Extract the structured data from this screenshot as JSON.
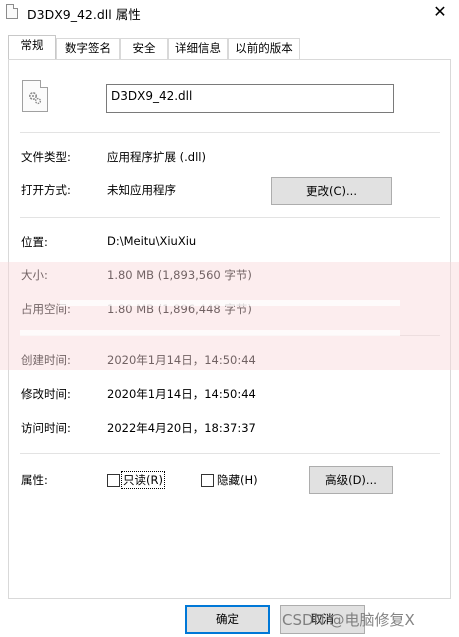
{
  "window": {
    "title": "D3DX9_42.dll 属性",
    "close_glyph": "✕"
  },
  "tabs": [
    {
      "label": "常规"
    },
    {
      "label": "数字签名"
    },
    {
      "label": "安全"
    },
    {
      "label": "详细信息"
    },
    {
      "label": "以前的版本"
    }
  ],
  "general": {
    "file_name": "D3DX9_42.dll",
    "file_type_label": "文件类型:",
    "file_type_value": "应用程序扩展 (.dll)",
    "opens_with_label": "打开方式:",
    "opens_with_value": "未知应用程序",
    "change_button": "更改(C)...",
    "location_label": "位置:",
    "location_value": "D:\\Meitu\\XiuXiu",
    "size_label": "大小:",
    "size_value": "1.80 MB (1,893,560 字节)",
    "size_on_disk_label": "占用空间:",
    "size_on_disk_value": "1.80 MB (1,896,448 字节)",
    "created_label": "创建时间:",
    "created_value": "2020年1月14日，14:50:44",
    "modified_label": "修改时间:",
    "modified_value": "2020年1月14日，14:50:44",
    "accessed_label": "访问时间:",
    "accessed_value": "2022年4月20日，18:37:37",
    "attributes_label": "属性:",
    "readonly_label": "只读(R)",
    "hidden_label": "隐藏(H)",
    "advanced_button": "高级(D)..."
  },
  "footer": {
    "ok_button": "确定",
    "cancel_button": "取消"
  },
  "overlay": {
    "watermark": "CSDN @电脑修复X"
  },
  "colors": {
    "accent": "#0078d7",
    "banner": "#f8d7da"
  },
  "icons": {
    "file_icon": "dll-file-gear-icon",
    "window_icon": "file-icon",
    "close": "close-icon"
  }
}
